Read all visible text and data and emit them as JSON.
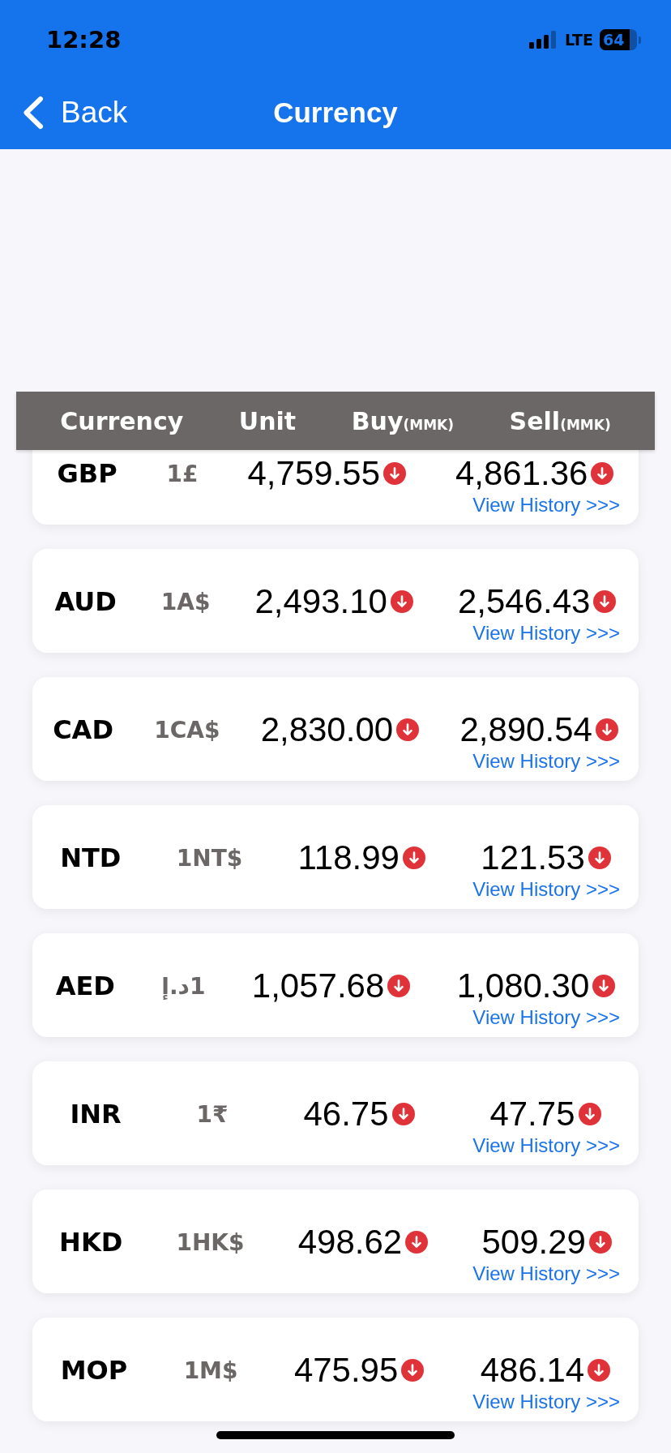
{
  "status_bar": {
    "time": "12:28",
    "network": "LTE",
    "battery": "64"
  },
  "nav_bar": {
    "back_label": "Back",
    "title": "Currency"
  },
  "table": {
    "columns": [
      {
        "label": "Currency"
      },
      {
        "label": "Unit"
      },
      {
        "label": "Buy",
        "suffix": "(MMK)"
      },
      {
        "label": "Sell",
        "suffix": "(MMK)"
      }
    ],
    "rows": [
      {
        "code": "GBP",
        "unit": "1£",
        "buy": "4,759.55",
        "buy_falling": true,
        "sell": "4,861.36",
        "sell_falling": true,
        "link": "View History >>>"
      },
      {
        "code": "AUD",
        "unit": "1A$",
        "buy": "2,493.10",
        "buy_falling": true,
        "sell": "2,546.43",
        "sell_falling": true,
        "link": "View History >>>"
      },
      {
        "code": "CAD",
        "unit": "1CA$",
        "buy": "2,830.00",
        "buy_falling": true,
        "sell": "2,890.54",
        "sell_falling": true,
        "link": "View History >>>"
      },
      {
        "code": "NTD",
        "unit": "1NT$",
        "buy": "118.99",
        "buy_falling": true,
        "sell": "121.53",
        "sell_falling": true,
        "link": "View History >>>"
      },
      {
        "code": "AED",
        "unit": "1د.إ",
        "buy": "1,057.68",
        "buy_falling": true,
        "sell": "1,080.30",
        "sell_falling": true,
        "link": "View History >>>"
      },
      {
        "code": "INR",
        "unit": "1₹",
        "buy": "46.75",
        "buy_falling": true,
        "sell": "47.75",
        "sell_falling": true,
        "link": "View History >>>"
      },
      {
        "code": "HKD",
        "unit": "1HK$",
        "buy": "498.62",
        "buy_falling": true,
        "sell": "509.29",
        "sell_falling": true,
        "link": "View History >>>"
      },
      {
        "code": "MOP",
        "unit": "1M$",
        "buy": "475.95",
        "buy_falling": true,
        "sell": "486.14",
        "sell_falling": true,
        "link": "View History >>>"
      }
    ]
  }
}
